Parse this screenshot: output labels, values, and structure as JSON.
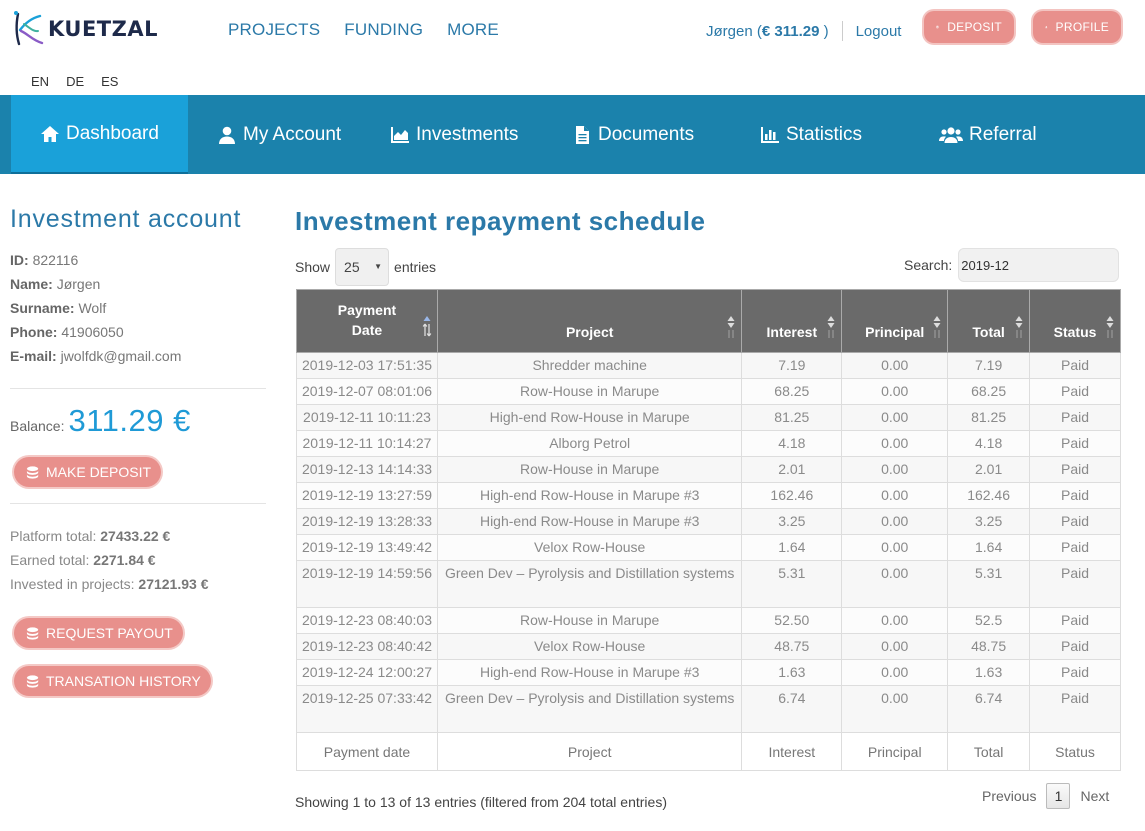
{
  "brand": {
    "name": "KUETZAL"
  },
  "mainnav": [
    "PROJECTS",
    "FUNDING",
    "MORE"
  ],
  "user": {
    "name": "Jørgen",
    "balance": "€ 311.29",
    "logout": "Logout"
  },
  "top_buttons": {
    "deposit": "DEPOSIT",
    "profile": "PROFILE"
  },
  "languages": [
    "EN",
    "DE",
    "ES"
  ],
  "navbar": [
    {
      "label": "Dashboard",
      "icon": "home-icon",
      "active": true
    },
    {
      "label": "My Account",
      "icon": "user-icon"
    },
    {
      "label": "Investments",
      "icon": "area-chart-icon"
    },
    {
      "label": "Documents",
      "icon": "document-icon"
    },
    {
      "label": "Statistics",
      "icon": "bar-chart-icon"
    },
    {
      "label": "Referral",
      "icon": "users-icon"
    }
  ],
  "account": {
    "title": "Investment account",
    "fields": [
      {
        "label": "ID:",
        "value": "822116"
      },
      {
        "label": "Name:",
        "value": "Jørgen"
      },
      {
        "label": "Surname:",
        "value": "Wolf"
      },
      {
        "label": "Phone:",
        "value": "41906050"
      },
      {
        "label": "E-mail:",
        "value": "jwolfdk@gmail.com"
      }
    ],
    "balance_label": "Balance:",
    "balance_value": "311.29 €",
    "make_deposit": "MAKE DEPOSIT",
    "totals": [
      {
        "label": "Platform total:",
        "value": "27433.22 €"
      },
      {
        "label": "Earned total:",
        "value": "2271.84 €"
      },
      {
        "label": "Invested in projects:",
        "value": "27121.93 €"
      }
    ],
    "request_payout": "REQUEST PAYOUT",
    "transaction_history": "TRANSATION HISTORY"
  },
  "schedule": {
    "title": "Investment repayment schedule",
    "show_label": "Show",
    "entries_value": "25",
    "entries_label": "entries",
    "search_label": "Search:",
    "search_value": "2019-12",
    "columns": [
      "Payment Date",
      "Project",
      "Interest",
      "Principal",
      "Total",
      "Status"
    ],
    "footer_columns": [
      "Payment date",
      "Project",
      "Interest",
      "Principal",
      "Total",
      "Status"
    ],
    "rows": [
      [
        "2019-12-03 17:51:35",
        "Shredder machine",
        "7.19",
        "0.00",
        "7.19",
        "Paid"
      ],
      [
        "2019-12-07 08:01:06",
        "Row-House in Marupe",
        "68.25",
        "0.00",
        "68.25",
        "Paid"
      ],
      [
        "2019-12-11 10:11:23",
        "High-end Row-House in Marupe",
        "81.25",
        "0.00",
        "81.25",
        "Paid"
      ],
      [
        "2019-12-11 10:14:27",
        "Alborg Petrol",
        "4.18",
        "0.00",
        "4.18",
        "Paid"
      ],
      [
        "2019-12-13 14:14:33",
        "Row-House in Marupe",
        "2.01",
        "0.00",
        "2.01",
        "Paid"
      ],
      [
        "2019-12-19 13:27:59",
        "High-end Row-House in Marupe #3",
        "162.46",
        "0.00",
        "162.46",
        "Paid"
      ],
      [
        "2019-12-19 13:28:33",
        "High-end Row-House in Marupe #3",
        "3.25",
        "0.00",
        "3.25",
        "Paid"
      ],
      [
        "2019-12-19 13:49:42",
        "Velox Row-House",
        "1.64",
        "0.00",
        "1.64",
        "Paid"
      ],
      [
        "2019-12-19 14:59:56",
        "Green Dev – Pyrolysis and Distillation systems",
        "5.31",
        "0.00",
        "5.31",
        "Paid"
      ],
      [
        "2019-12-23 08:40:03",
        "Row-House in Marupe",
        "52.50",
        "0.00",
        "52.5",
        "Paid"
      ],
      [
        "2019-12-23 08:40:42",
        "Velox Row-House",
        "48.75",
        "0.00",
        "48.75",
        "Paid"
      ],
      [
        "2019-12-24 12:00:27",
        "High-end Row-House in Marupe #3",
        "1.63",
        "0.00",
        "1.63",
        "Paid"
      ],
      [
        "2019-12-25 07:33:42",
        "Green Dev – Pyrolysis and Distillation systems",
        "6.74",
        "0.00",
        "6.74",
        "Paid"
      ]
    ],
    "showing_text": "Showing 1 to 13 of 13 entries (filtered from 204 total entries)",
    "pager": {
      "previous": "Previous",
      "page": "1",
      "next": "Next"
    }
  },
  "colors": {
    "brand_blue": "#1b82ac",
    "active_blue": "#1aa1d9",
    "title_blue": "#2b79a8",
    "pill_pink": "#e8908c",
    "table_header": "#6a6a6a"
  }
}
